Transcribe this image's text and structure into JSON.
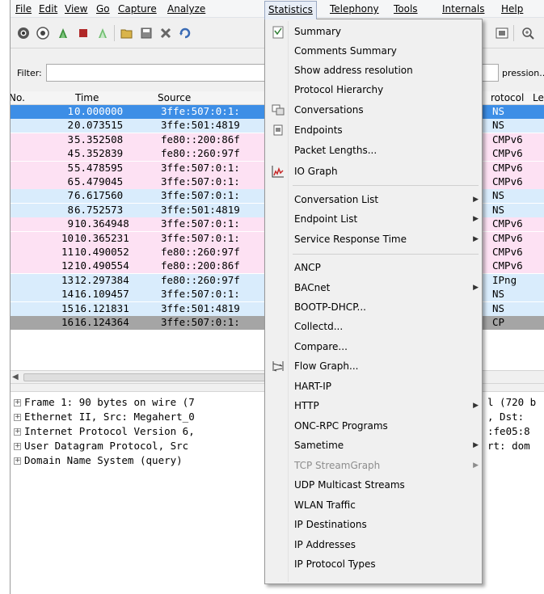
{
  "menubar": {
    "items": [
      "File",
      "Edit",
      "View",
      "Go",
      "Capture",
      "Analyze",
      "Statistics",
      "Telephony",
      "Tools",
      "Internals",
      "Help"
    ]
  },
  "filter": {
    "label": "Filter:",
    "value": "",
    "expression_label": "pression..."
  },
  "packet_list": {
    "columns": [
      "No.",
      "Time",
      "Source",
      "rotocol",
      "Le"
    ],
    "rows": [
      {
        "no": "1",
        "time": "0.000000",
        "source": "3ffe:507:0:1:",
        "protocol": "NS"
      },
      {
        "no": "2",
        "time": "0.073515",
        "source": "3ffe:501:4819",
        "protocol": "NS"
      },
      {
        "no": "3",
        "time": "5.352508",
        "source": "fe80::200:86f",
        "protocol": "CMPv6"
      },
      {
        "no": "4",
        "time": "5.352839",
        "source": "fe80::260:97f",
        "protocol": "CMPv6"
      },
      {
        "no": "5",
        "time": "5.478595",
        "source": "3ffe:507:0:1:",
        "protocol": "CMPv6"
      },
      {
        "no": "6",
        "time": "5.479045",
        "source": "3ffe:507:0:1:",
        "protocol": "CMPv6"
      },
      {
        "no": "7",
        "time": "6.617560",
        "source": "3ffe:507:0:1:",
        "protocol": "NS"
      },
      {
        "no": "8",
        "time": "6.752573",
        "source": "3ffe:501:4819",
        "protocol": "NS"
      },
      {
        "no": "9",
        "time": "10.364948",
        "source": "3ffe:507:0:1:",
        "protocol": "CMPv6"
      },
      {
        "no": "10",
        "time": "10.365231",
        "source": "3ffe:507:0:1:",
        "protocol": "CMPv6"
      },
      {
        "no": "11",
        "time": "10.490052",
        "source": "fe80::260:97f",
        "protocol": "CMPv6"
      },
      {
        "no": "12",
        "time": "10.490554",
        "source": "fe80::200:86f",
        "protocol": "CMPv6"
      },
      {
        "no": "13",
        "time": "12.297384",
        "source": "fe80::260:97f",
        "protocol": "IPng"
      },
      {
        "no": "14",
        "time": "16.109457",
        "source": "3ffe:507:0:1:",
        "protocol": "NS"
      },
      {
        "no": "15",
        "time": "16.121831",
        "source": "3ffe:501:4819",
        "protocol": "NS"
      },
      {
        "no": "16",
        "time": "16.124364",
        "source": "3ffe:507:0:1:",
        "protocol": "CP"
      }
    ]
  },
  "details": {
    "rows": [
      {
        "text": "Frame 1: 90 bytes on wire (7",
        "right": "l (720 b"
      },
      {
        "text": "Ethernet II, Src: Megahert_0",
        "right": ", Dst:"
      },
      {
        "text": "Internet Protocol Version 6,",
        "right": ":fe05:8"
      },
      {
        "text": "User Datagram Protocol, Src",
        "right": "rt: dom"
      },
      {
        "text": "Domain Name System (query)",
        "right": ""
      }
    ]
  },
  "statistics_menu": {
    "items": [
      {
        "label": "Summary",
        "icon": "summary-icon"
      },
      {
        "label": "Comments Summary"
      },
      {
        "label": "Show address resolution"
      },
      {
        "label": "Protocol Hierarchy"
      },
      {
        "label": "Conversations",
        "icon": "conversations-icon"
      },
      {
        "label": "Endpoints",
        "icon": "endpoints-icon"
      },
      {
        "label": "Packet Lengths..."
      },
      {
        "label": "IO Graph",
        "icon": "io-graph-icon"
      },
      {
        "label": "Conversation List",
        "submenu": true
      },
      {
        "label": "Endpoint List",
        "submenu": true
      },
      {
        "label": "Service Response Time",
        "submenu": true
      },
      {
        "label": "ANCP"
      },
      {
        "label": "BACnet",
        "submenu": true
      },
      {
        "label": "BOOTP-DHCP..."
      },
      {
        "label": "Collectd..."
      },
      {
        "label": "Compare..."
      },
      {
        "label": "Flow Graph...",
        "icon": "flow-graph-icon"
      },
      {
        "label": "HART-IP"
      },
      {
        "label": "HTTP",
        "submenu": true
      },
      {
        "label": "ONC-RPC Programs"
      },
      {
        "label": "Sametime",
        "submenu": true
      },
      {
        "label": "TCP StreamGraph",
        "submenu": true,
        "disabled": true
      },
      {
        "label": "UDP Multicast Streams"
      },
      {
        "label": "WLAN Traffic"
      },
      {
        "label": "IP Destinations"
      },
      {
        "label": "IP Addresses"
      },
      {
        "label": "IP Protocol Types"
      }
    ]
  },
  "colors": {
    "selected_row": "#3d8ee6",
    "blue_row": "#d9ecfc",
    "pink_row": "#fde1f3",
    "gray_row": "#a5a5a5"
  }
}
